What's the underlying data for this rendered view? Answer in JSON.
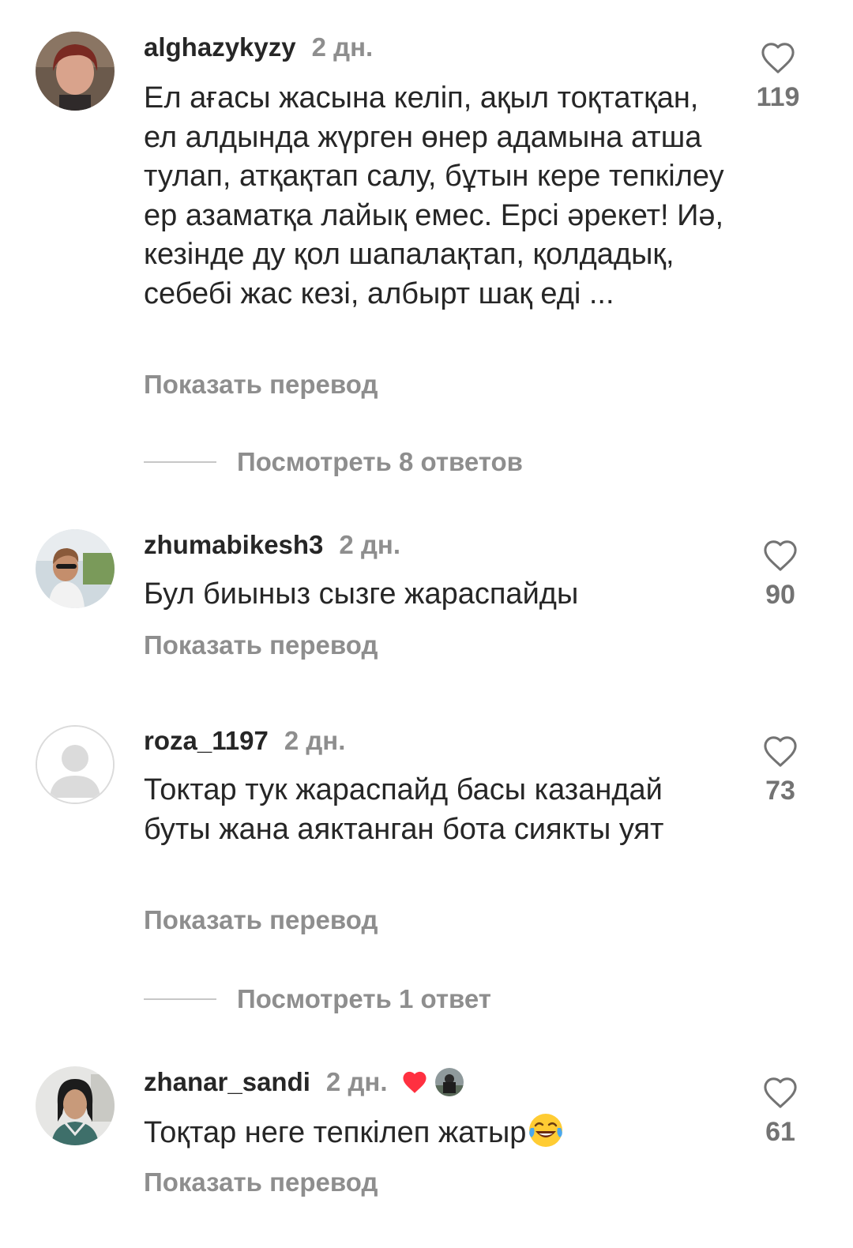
{
  "comments": [
    {
      "username": "alghazykyzy",
      "time": "2 дн.",
      "text": "Ел ағасы жасына келіп, ақыл тоқтатқан, ел алдында жүрген өнер адамына атша тулап, атқақтап салу, бұтын кере тепкілеу ер азаматқа лайық емес. Ерсі әрекет! Иә, кезінде ду қол шапалақтап, қолдадық, себебі жас кезі, албырт шақ еді ...",
      "translate": "Показать перевод",
      "likes": "119",
      "replies": "Посмотреть 8 ответов"
    },
    {
      "username": "zhumabikesh3",
      "time": "2 дн.",
      "text": "Бул биыныз сызге жараспайды",
      "translate": "Показать перевод",
      "likes": "90"
    },
    {
      "username": "roza_1197",
      "time": "2 дн.",
      "text": "Токтар тук жараспайд басы казандай буты жана аяктанган бота сиякты уят",
      "translate": "Показать перевод",
      "likes": "73",
      "replies": "Посмотреть 1 ответ"
    },
    {
      "username": "zhanar_sandi",
      "time": "2 дн.",
      "text": "Тоқтар неге тепкілеп жатыр",
      "translate": "Показать перевод",
      "likes": "61",
      "author_liked": true
    }
  ],
  "icons": {
    "like": "heart-outline-icon",
    "author_like": "heart-filled-icon",
    "emoji": "face-with-tears-of-joy-icon"
  },
  "colors": {
    "text": "#262626",
    "secondary": "#8e8e8e",
    "heart_red": "#ff3040"
  }
}
